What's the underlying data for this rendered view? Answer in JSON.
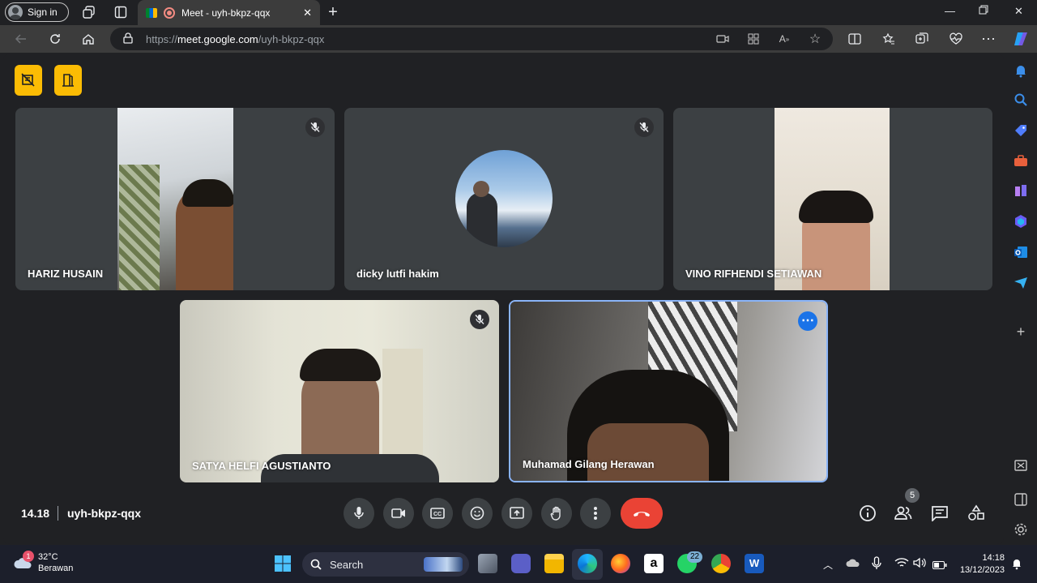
{
  "browser": {
    "sign_in": "Sign in",
    "tab_title": "Meet - uyh-bkpz-qqx",
    "url_scheme": "https://",
    "url_host": "meet.google.com",
    "url_path": "/uyh-bkpz-qqx"
  },
  "meet": {
    "participants": [
      {
        "name": "HARIZ HUSAIN",
        "muted": true
      },
      {
        "name": "dicky lutfi hakim",
        "muted": true
      },
      {
        "name": "VINO RIFHENDI SETIAWAN",
        "muted": false
      },
      {
        "name": "SATYA HELFI AGUSTIANTO",
        "muted": true
      },
      {
        "name": "Muhamad Gilang Herawan",
        "muted": false
      }
    ],
    "time": "14.18",
    "meeting_code": "uyh-bkpz-qqx",
    "people_count": "5",
    "accent_color": "#fbbc04",
    "end_call_color": "#ea4335"
  },
  "taskbar": {
    "temperature": "32°C",
    "condition": "Berawan",
    "weather_badge": "1",
    "search_placeholder": "Search",
    "whatsapp_badge": "22",
    "clock_time": "14:18",
    "clock_date": "13/12/2023"
  }
}
